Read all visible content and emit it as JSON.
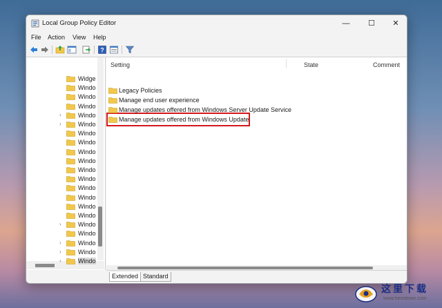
{
  "window": {
    "title": "Local Group Policy Editor",
    "controls": {
      "minimize": "—",
      "maximize": "☐",
      "close": "✕"
    }
  },
  "menubar": {
    "items": [
      "File",
      "Action",
      "View",
      "Help"
    ]
  },
  "toolbar": {
    "buttons": [
      "back-arrow-icon",
      "forward-arrow-icon",
      "up-folder-icon",
      "show-tree-icon",
      "export-list-icon",
      "help-icon",
      "properties-icon",
      "filter-icon"
    ]
  },
  "tree": {
    "items": [
      {
        "label": "Widge",
        "expandable": false,
        "selected": false
      },
      {
        "label": "Windo",
        "expandable": false,
        "selected": false
      },
      {
        "label": "Windo",
        "expandable": false,
        "selected": false
      },
      {
        "label": "Windo",
        "expandable": false,
        "selected": false
      },
      {
        "label": "Windo",
        "expandable": true,
        "selected": false
      },
      {
        "label": "Windo",
        "expandable": true,
        "selected": false
      },
      {
        "label": "Windo",
        "expandable": false,
        "selected": false
      },
      {
        "label": "Windo",
        "expandable": false,
        "selected": false
      },
      {
        "label": "Windo",
        "expandable": false,
        "selected": false
      },
      {
        "label": "Windo",
        "expandable": false,
        "selected": false
      },
      {
        "label": "Windo",
        "expandable": false,
        "selected": false
      },
      {
        "label": "Windo",
        "expandable": false,
        "selected": false
      },
      {
        "label": "Windo",
        "expandable": false,
        "selected": false
      },
      {
        "label": "Windo",
        "expandable": false,
        "selected": false
      },
      {
        "label": "Windo",
        "expandable": false,
        "selected": false
      },
      {
        "label": "Windo",
        "expandable": false,
        "selected": false
      },
      {
        "label": "Windo",
        "expandable": true,
        "selected": false
      },
      {
        "label": "Windo",
        "expandable": false,
        "selected": false
      },
      {
        "label": "Windo",
        "expandable": true,
        "selected": false
      },
      {
        "label": "Windo",
        "expandable": true,
        "selected": false
      },
      {
        "label": "Windo",
        "expandable": true,
        "selected": true
      }
    ]
  },
  "list": {
    "columns": {
      "setting": "Setting",
      "state": "State",
      "comment": "Comment"
    },
    "items": [
      {
        "label": "Legacy Policies"
      },
      {
        "label": "Manage end user experience"
      },
      {
        "label": "Manage updates offered from Windows Server Update Service"
      },
      {
        "label": "Manage updates offered from Windows Update",
        "highlighted": true
      }
    ]
  },
  "tabs": [
    {
      "label": "Extended",
      "active": true
    },
    {
      "label": "Standard",
      "active": false
    }
  ],
  "watermark": {
    "text": "这里下载",
    "url": "www.heredown.com"
  },
  "colors": {
    "highlight": "#d4161b",
    "folder": "#f2c84b"
  }
}
